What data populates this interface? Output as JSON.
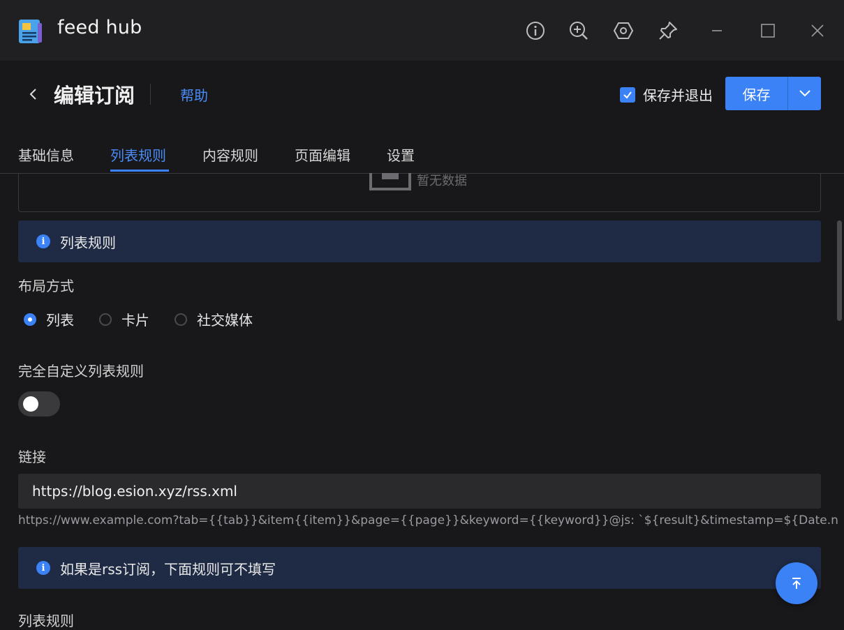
{
  "app": {
    "title": "feed hub",
    "toolbar_icons": [
      "info-icon",
      "zoom-in-icon",
      "hexagon-settings-icon",
      "pin-icon"
    ],
    "window_controls": [
      "minimize-icon",
      "maximize-icon",
      "close-icon"
    ]
  },
  "header": {
    "title": "编辑订阅",
    "help_label": "帮助",
    "save_and_exit_label": "保存并退出",
    "save_and_exit_checked": true,
    "save_label": "保存"
  },
  "tabs": [
    {
      "label": "基础信息",
      "active": false
    },
    {
      "label": "列表规则",
      "active": true
    },
    {
      "label": "内容规则",
      "active": false
    },
    {
      "label": "页面编辑",
      "active": false
    },
    {
      "label": "设置",
      "active": false
    }
  ],
  "content": {
    "empty_text": "暂无数据",
    "alert_list_rules": "列表规则",
    "layout_label": "布局方式",
    "layout_options": [
      {
        "label": "列表",
        "checked": true
      },
      {
        "label": "卡片",
        "checked": false
      },
      {
        "label": "社交媒体",
        "checked": false
      }
    ],
    "custom_rules_label": "完全自定义列表规则",
    "custom_rules_enabled": false,
    "link_label": "链接",
    "link_value": "https://blog.esion.xyz/rss.xml",
    "link_hint": "https://www.example.com?tab={{tab}}&item{{item}}&page={{page}}&keyword={{keyword}}@js: `${result}&timestamp=${Date.now()}`",
    "alert_rss": "如果是rss订阅，下面规则可不填写",
    "list_rules_label": "列表规则"
  },
  "colors": {
    "accent": "#3b82f6",
    "background": "#18181b",
    "titlebar": "#202022",
    "alert_bg": "#1f2a44"
  }
}
